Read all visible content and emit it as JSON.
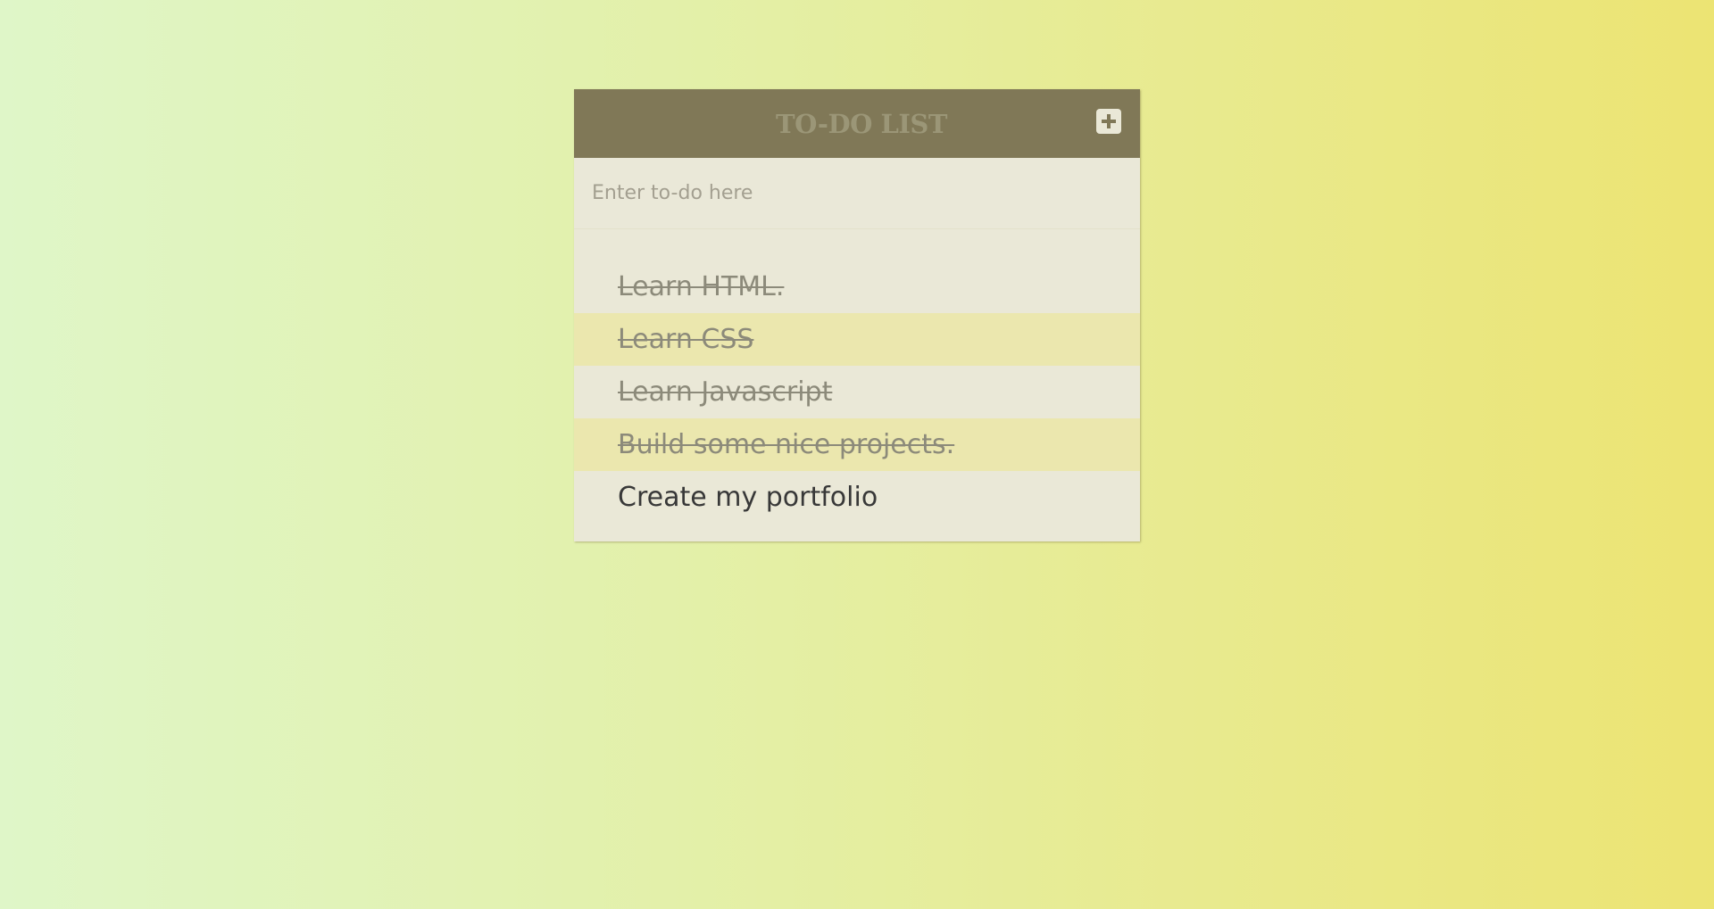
{
  "header": {
    "title": "TO-DO LIST",
    "add_icon": "plus-icon"
  },
  "input": {
    "placeholder": "Enter to-do here",
    "value": ""
  },
  "todos": [
    {
      "text": "Learn HTML.",
      "completed": true
    },
    {
      "text": "Learn CSS",
      "completed": true
    },
    {
      "text": "Learn Javascript",
      "completed": true
    },
    {
      "text": "Build some nice projects.",
      "completed": true
    },
    {
      "text": "Create my portfolio",
      "completed": false
    }
  ],
  "colors": {
    "header_bg": "#807857",
    "title_text": "#9b9677",
    "panel_bg": "#eae8d7",
    "stripe_bg": "#ebe7ae",
    "completed_text": "#8c8a7a",
    "active_text": "#383838"
  }
}
